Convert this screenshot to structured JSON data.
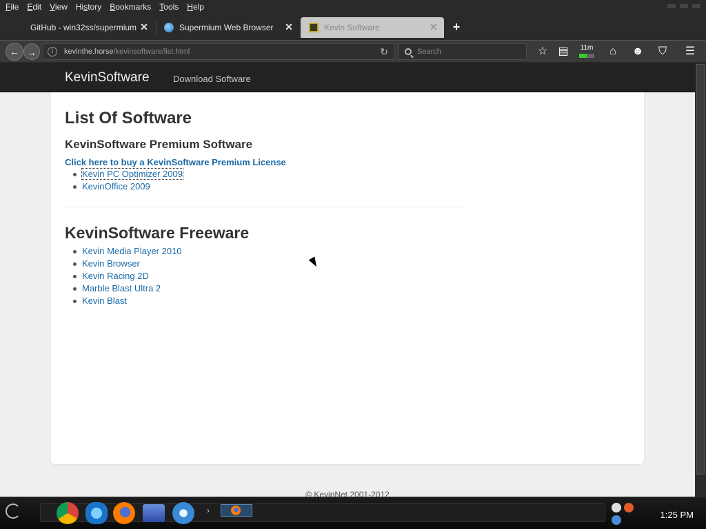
{
  "menubar": {
    "items": [
      {
        "underline": "F",
        "rest": "ile"
      },
      {
        "underline": "E",
        "rest": "dit"
      },
      {
        "underline": "V",
        "rest": "iew"
      },
      {
        "pre": "Hi",
        "underline": "s",
        "rest": "tory"
      },
      {
        "underline": "B",
        "rest": "ookmarks"
      },
      {
        "underline": "T",
        "rest": "ools"
      },
      {
        "underline": "H",
        "rest": "elp"
      }
    ]
  },
  "tabs": [
    {
      "title": "GitHub - win32ss/supermium: ...",
      "favicon": "github-icon",
      "active": false
    },
    {
      "title": "Supermium Web Browser",
      "favicon": "supermium-icon",
      "active": false
    },
    {
      "title": "Kevin Software",
      "favicon": "kevinsoftware-icon",
      "active": true
    }
  ],
  "navbar": {
    "url_host": "kevinthe.horse",
    "url_path": "/kevinsoftware/list.html",
    "search_placeholder": "Search",
    "timer_label": "11m"
  },
  "site": {
    "brand": "KevinSoftware",
    "nav_link": "Download Software",
    "heading": "List Of Software",
    "premium_heading": "KevinSoftware Premium Software",
    "buy_link": "Click here to buy a KevinSoftware Premium License",
    "premium_items": [
      "Kevin PC Optimizer 2009",
      "KevinOffice 2009"
    ],
    "freeware_heading": "KevinSoftware Freeware",
    "freeware_items": [
      "Kevin Media Player 2010",
      "Kevin Browser",
      "Kevin Racing 2D",
      "Marble Blast Ultra 2",
      "Kevin Blast"
    ],
    "footer": "© KevinNet 2001-2012"
  },
  "taskbar": {
    "clock": "1:25 PM",
    "apps": [
      "chrome-icon",
      "internet-explorer-icon",
      "firefox-icon",
      "media-center-icon",
      "media-player-icon"
    ]
  },
  "colors": {
    "link": "#1a6aa8",
    "nav_bg": "#222222",
    "page_bg": "#efefef"
  }
}
